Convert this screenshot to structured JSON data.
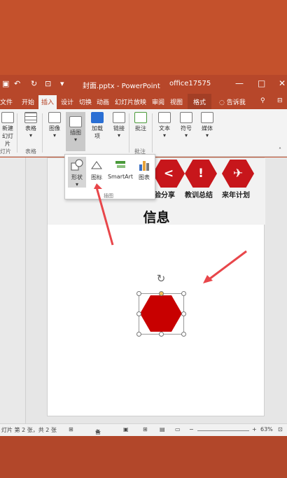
{
  "titlebar": {
    "document_title": "封面.pptx - PowerPoint",
    "account": "office17575",
    "save_icon": "save-icon",
    "undo_icon": "undo-icon",
    "redo_icon": "redo-icon",
    "minimize": "—",
    "restore": "□",
    "close": "✕"
  },
  "tabs": [
    "文件",
    "开始",
    "插入",
    "设计",
    "切换",
    "动画",
    "幻灯片放映",
    "审阅",
    "视图"
  ],
  "active_tab": "插入",
  "format_tab": "格式",
  "tell_me": "告诉我",
  "ribbon": {
    "new_slide": "新建\n幻灯片",
    "new_slide_group": "灯片",
    "table": "表格",
    "table_group": "表格",
    "images": "图像",
    "illustrations": "插图",
    "addins": "加载\n项",
    "links": "链接",
    "comment": "批注",
    "comment_group": "批注",
    "text": "文本",
    "symbols": "符号",
    "media": "媒体"
  },
  "dropdown": {
    "items": [
      "形状",
      "图标",
      "SmartArt",
      "图表"
    ],
    "group_label": "插图"
  },
  "slide": {
    "captions": [
      "验分享",
      "教训总结",
      "来年计划"
    ],
    "title": "信息"
  },
  "statusbar": {
    "slide_info": "灯片 第 2 张，共 2 张",
    "notes": "备注",
    "zoom": "63%"
  },
  "colors": {
    "accent": "#b7472a",
    "shape_fill": "#c80000",
    "icon_fill": "#c7161b",
    "annotation_arrow": "#e8464a"
  }
}
